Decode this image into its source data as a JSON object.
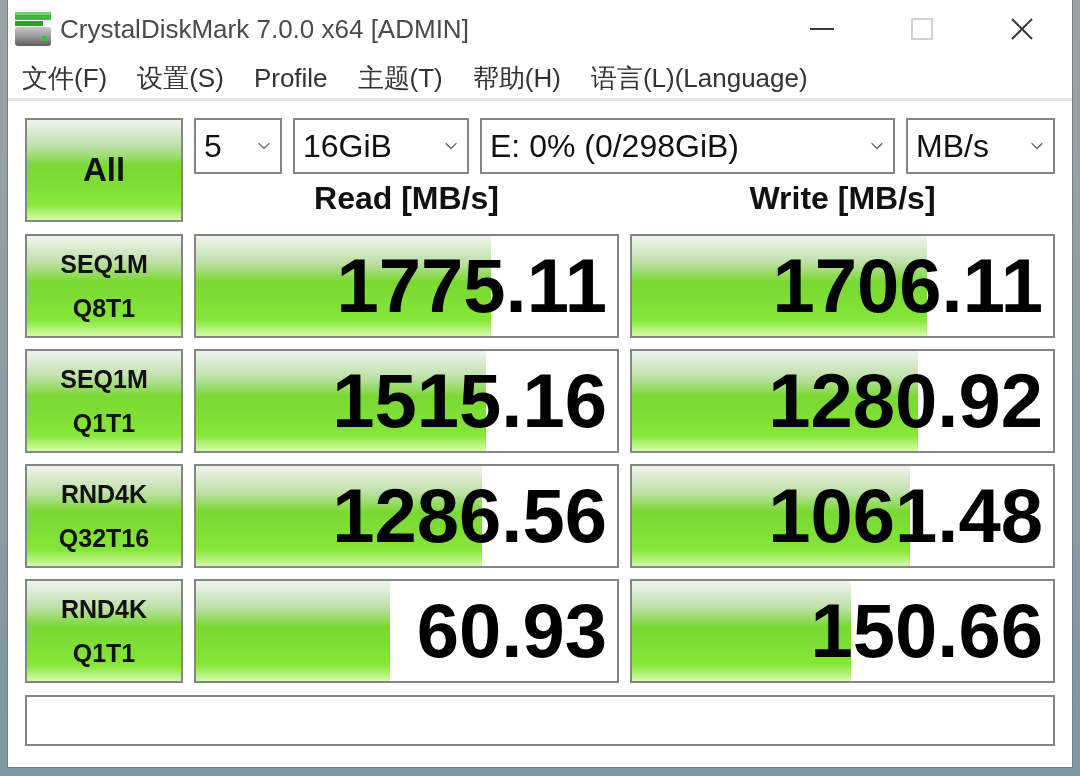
{
  "window": {
    "title": "CrystalDiskMark 7.0.0 x64 [ADMIN]"
  },
  "window_controls": [
    {
      "kind": "minimize",
      "disabled": false
    },
    {
      "kind": "maximize",
      "disabled": true
    },
    {
      "kind": "close",
      "disabled": false
    }
  ],
  "menu": [
    "文件(F)",
    "设置(S)",
    "Profile",
    "主题(T)",
    "帮助(H)",
    "语言(L)(Language)"
  ],
  "all_button": {
    "label": "All"
  },
  "selectors": [
    {
      "value": "5"
    },
    {
      "value": "16GiB"
    },
    {
      "value": "E: 0% (0/298GiB)"
    },
    {
      "value": "MB/s"
    }
  ],
  "columns": [
    "Read [MB/s]",
    "Write [MB/s]"
  ],
  "tests": [
    {
      "label": "SEQ1M\nQ8T1",
      "read": {
        "value": "1775.11",
        "level": 0.7
      },
      "write": {
        "value": "1706.11",
        "level": 0.7
      }
    },
    {
      "label": "SEQ1M\nQ1T1",
      "read": {
        "value": "1515.16",
        "level": 0.69
      },
      "write": {
        "value": "1280.92",
        "level": 0.68
      }
    },
    {
      "label": "RND4K\nQ32T16",
      "read": {
        "value": "1286.56",
        "level": 0.68
      },
      "write": {
        "value": "1061.48",
        "level": 0.66
      }
    },
    {
      "label": "RND4K\nQ1T1",
      "read": {
        "value": "60.93",
        "level": 0.46
      },
      "write": {
        "value": "150.66",
        "level": 0.52
      }
    }
  ]
}
